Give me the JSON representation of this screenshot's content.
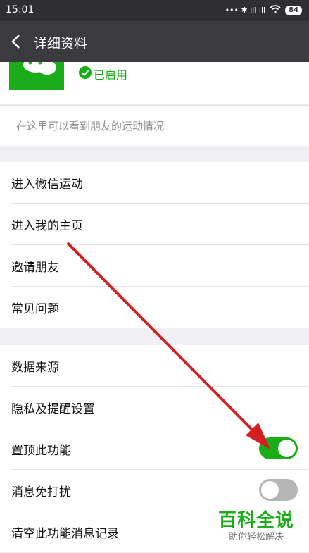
{
  "status_bar": {
    "time": "15:01",
    "signal_text": "••• ✱ ıll ıll",
    "battery": "84"
  },
  "title_bar": {
    "title": "详细资料"
  },
  "profile": {
    "status_label": "已启用"
  },
  "description": "在这里可以看到朋友的运动情况",
  "group1": [
    "进入微信运动",
    "进入我的主页",
    "邀请朋友",
    "常见问题"
  ],
  "group2": {
    "items": [
      "数据来源",
      "隐私及提醒设置"
    ],
    "toggle_pin": {
      "label": "置顶此功能",
      "on": true
    },
    "toggle_dnd": {
      "label": "消息免打扰",
      "on": false
    },
    "clear_history": "清空此功能消息记录"
  },
  "watermark": {
    "title": "百科全说",
    "subtitle": "助你轻松解决"
  },
  "colors": {
    "brand_green": "#1aad19",
    "arrow_red": "#d42020"
  }
}
